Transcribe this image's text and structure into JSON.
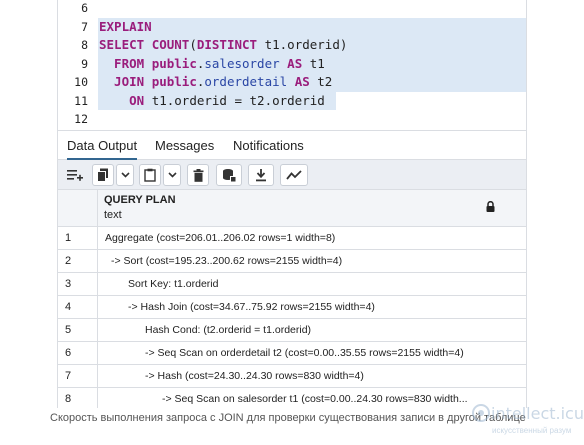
{
  "editor": {
    "lines": [
      {
        "num": "6",
        "tokens": []
      },
      {
        "num": "7",
        "tokens": [
          {
            "t": "EXPLAIN",
            "c": "kw"
          }
        ]
      },
      {
        "num": "8",
        "tokens": [
          {
            "t": "SELECT ",
            "c": "kw"
          },
          {
            "t": "COUNT",
            "c": "kw"
          },
          {
            "t": "(",
            "c": ""
          },
          {
            "t": "DISTINCT ",
            "c": "kw"
          },
          {
            "t": "t1.orderid)",
            "c": ""
          }
        ]
      },
      {
        "num": "9",
        "tokens": [
          {
            "t": "  FROM ",
            "c": "kw"
          },
          {
            "t": "public",
            "c": "kw"
          },
          {
            "t": ".",
            "c": ""
          },
          {
            "t": "salesorder",
            "c": "ident"
          },
          {
            "t": " AS ",
            "c": "kw"
          },
          {
            "t": "t1",
            "c": ""
          }
        ]
      },
      {
        "num": "10",
        "tokens": [
          {
            "t": "  JOIN ",
            "c": "kw"
          },
          {
            "t": "public",
            "c": "kw"
          },
          {
            "t": ".",
            "c": ""
          },
          {
            "t": "orderdetail",
            "c": "ident"
          },
          {
            "t": " AS ",
            "c": "kw"
          },
          {
            "t": "t2",
            "c": ""
          }
        ]
      },
      {
        "num": "11",
        "tokens": [
          {
            "t": "    ON ",
            "c": "kw"
          },
          {
            "t": "t1.orderid = t2.orderid",
            "c": ""
          }
        ]
      },
      {
        "num": "12",
        "tokens": []
      }
    ]
  },
  "tabs": [
    {
      "label": "Data Output",
      "active": true
    },
    {
      "label": "Messages",
      "active": false
    },
    {
      "label": "Notifications",
      "active": false
    }
  ],
  "toolbar": {
    "buttons": [
      "add-row-icon",
      "copy-icon",
      "chevron-down-icon",
      "paste-icon",
      "chevron-down-icon",
      "delete-icon",
      "save-data-icon",
      "download-icon",
      "graph-icon"
    ]
  },
  "grid": {
    "column": {
      "name": "QUERY PLAN",
      "type": "text"
    },
    "rows": [
      {
        "num": "1",
        "indent": 0,
        "text": "Aggregate  (cost=206.01..206.02 rows=1 width=8)"
      },
      {
        "num": "2",
        "indent": 1,
        "text": "-> Sort  (cost=195.23..200.62 rows=2155 width=4)"
      },
      {
        "num": "3",
        "indent": 2,
        "text": "Sort Key: t1.orderid"
      },
      {
        "num": "4",
        "indent": 2,
        "text": "-> Hash Join  (cost=34.67..75.92 rows=2155 width=4)"
      },
      {
        "num": "5",
        "indent": 3,
        "text": "Hash Cond: (t2.orderid = t1.orderid)"
      },
      {
        "num": "6",
        "indent": 3,
        "text": "-> Seq Scan on orderdetail t2  (cost=0.00..35.55 rows=2155 width=4)"
      },
      {
        "num": "7",
        "indent": 3,
        "text": "-> Hash  (cost=24.30..24.30 rows=830 width=4)"
      },
      {
        "num": "8",
        "indent": 4,
        "text": "-> Seq Scan on salesorder t1  (cost=0.00..24.30 rows=830 width..."
      }
    ]
  },
  "caption": "Скорость выполнения запроса с JOIN для проверки существования записи в другой таблице",
  "watermark": {
    "title": "intellect.icu",
    "subtitle": "искусственный разум"
  },
  "colors": {
    "keyword": "#9a1d7c",
    "identifier": "#2a46a5",
    "highlight": "#dce8f5",
    "active_tab": "#326690"
  }
}
